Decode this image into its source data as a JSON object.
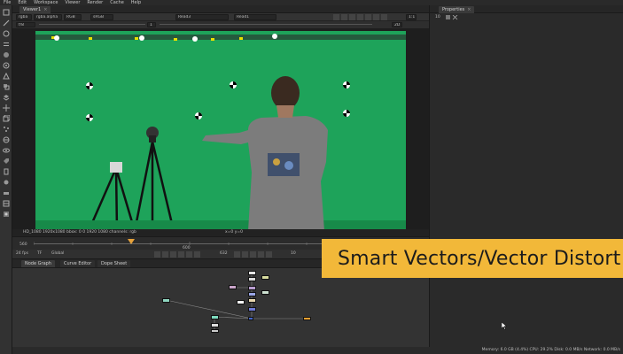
{
  "menu": [
    "File",
    "Edit",
    "Workspace",
    "Viewer",
    "Render",
    "Cache",
    "Help"
  ],
  "viewer": {
    "tab_label": "Viewer1",
    "tab_close": "×",
    "channels": "rgba",
    "channels_alpha": "rgba.alpha",
    "colorspace": "RGB",
    "lut": "sRGB",
    "input_a": "Read3",
    "input_b": "Read1",
    "zoom": "1:1",
    "format_badge": "2D",
    "frame_gain": "f/8",
    "gamma": "1",
    "info_left": "HD_1080 1920x1080  bbox: 0 0 1920 1080 channels: rgb",
    "info_coords": "x=0 y=0"
  },
  "timeline": {
    "fps": "24 fps",
    "tf": "TF",
    "scope": "Global",
    "current_frame": "632",
    "step": "10",
    "mid_label": "600",
    "start_label": "560"
  },
  "nodegraph": {
    "tabs": [
      "Node Graph",
      "Curve Editor",
      "Dope Sheet"
    ]
  },
  "properties": {
    "tab_label": "Properties",
    "max_panels": "10"
  },
  "status": {
    "text": "Memory: 6.0 GB (4.4%)  CPU: 29.2%  Disk: 0.0 MB/s  Network: 0.0 MB/s"
  },
  "banner": {
    "text": "Smart Vectors/Vector Distort"
  },
  "colors": {
    "banner_bg": "#f2b839",
    "greenscreen": "#1ea35a",
    "ui_bg": "#2b2b2b",
    "playhead": "#e8a23a"
  }
}
